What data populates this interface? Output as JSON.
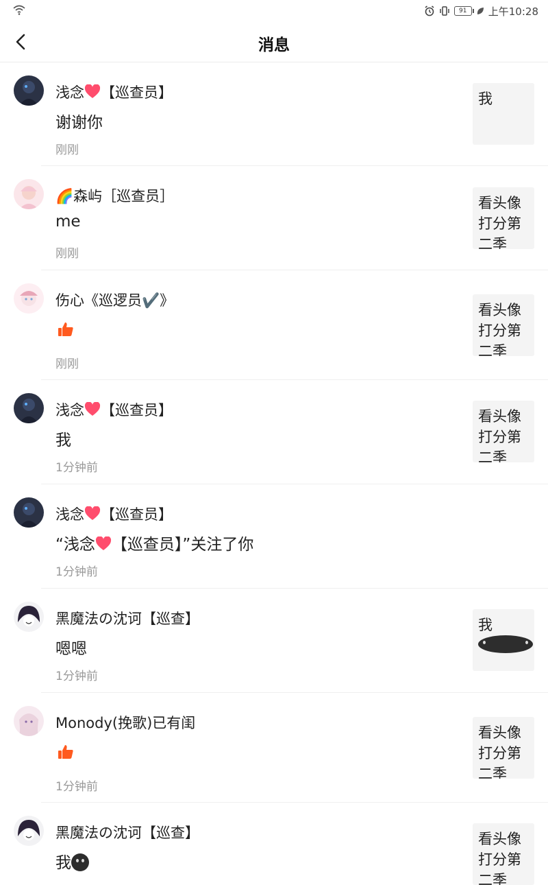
{
  "status_bar": {
    "battery": "91",
    "time": "上午10:28"
  },
  "header": {
    "title": "消息"
  },
  "colors": {
    "accent": "#ff5a1f",
    "time_gray": "#999999"
  },
  "messages": [
    {
      "user": "浅念",
      "tag": "【巡查员】",
      "text": "谢谢你",
      "time": "刚刚",
      "thumb": "我"
    },
    {
      "user": "🌈森屿［巡查员］",
      "text": "me",
      "time": "刚刚",
      "thumb": "看头像打分第二季"
    },
    {
      "user": "伤心《巡逻员✔️》",
      "text": "",
      "like": true,
      "time": "刚刚",
      "thumb": "看头像打分第二季"
    },
    {
      "user": "浅念",
      "tag": "【巡查员】",
      "text": "我",
      "time": "1分钟前",
      "thumb": "看头像打分第二季"
    },
    {
      "user": "浅念",
      "tag": "【巡查员】",
      "text_pre": "“浅念",
      "text_post": "【巡查员】”关注了你",
      "time": "1分钟前"
    },
    {
      "user": "黑魔法の沈诃【巡查】",
      "text": "嗯嗯",
      "time": "1分钟前",
      "thumb": "我"
    },
    {
      "user": "Monody(挽歌)已有闺",
      "text": "",
      "like": true,
      "time": "1分钟前",
      "thumb": "看头像打分第二季"
    },
    {
      "user": "黑魔法の沈诃【巡查】",
      "text": "我",
      "time": "",
      "thumb": "看头像打分第二季"
    }
  ]
}
